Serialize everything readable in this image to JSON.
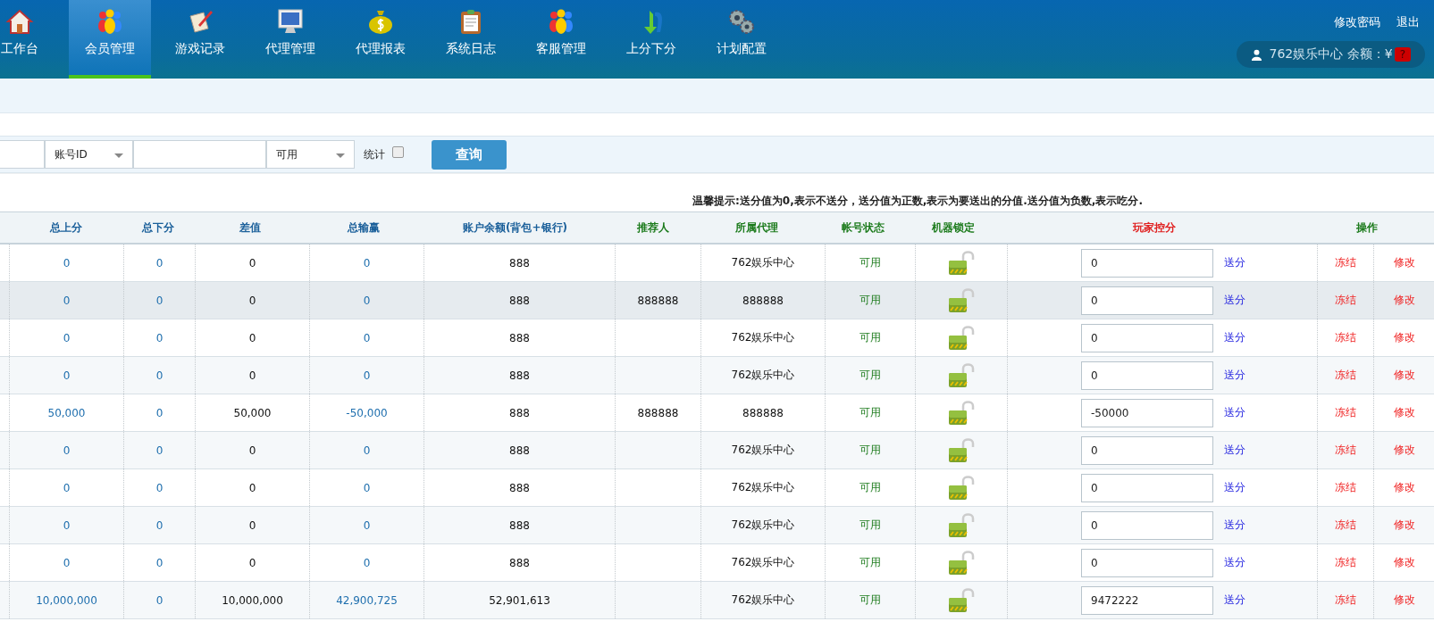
{
  "nav": [
    {
      "label": "工作台",
      "selected": false
    },
    {
      "label": "会员管理",
      "selected": true
    },
    {
      "label": "游戏记录",
      "selected": false
    },
    {
      "label": "代理管理",
      "selected": false
    },
    {
      "label": "代理报表",
      "selected": false
    },
    {
      "label": "系统日志",
      "selected": false
    },
    {
      "label": "客服管理",
      "selected": false
    },
    {
      "label": "上分下分",
      "selected": false
    },
    {
      "label": "计划配置",
      "selected": false
    }
  ],
  "top_links": [
    "修改密码",
    "退出"
  ],
  "account": {
    "text": "762娱乐中心 余额：¥",
    "badge": "?"
  },
  "filter": {
    "field_type": "账号ID",
    "status": "可用",
    "stat_label": "统计",
    "stat_checked": false,
    "query_button": "查询"
  },
  "notice": "温馨提示:送分值为0,表示不送分，送分值为正数,表示为要送出的分值.送分值为负数,表示吃分.",
  "table": {
    "columns": [
      "总上分",
      "总下分",
      "差值",
      "总输赢",
      "账户余额(背包+银行)",
      "推荐人",
      "所属代理",
      "帐号状态",
      "机器锁定",
      "玩家控分",
      "操作"
    ],
    "rows": [
      {
        "selected": false,
        "cells": [
          "0",
          "0",
          "0",
          "0",
          "888",
          "",
          "762娱乐中心",
          "可用"
        ],
        "score": "0",
        "actions": [
          "送分",
          "冻结",
          "修改"
        ]
      },
      {
        "selected": true,
        "cells": [
          "0",
          "0",
          "0",
          "0",
          "888",
          "888888",
          "888888",
          "可用"
        ],
        "score": "0",
        "actions": [
          "送分",
          "冻结",
          "修改"
        ]
      },
      {
        "selected": false,
        "cells": [
          "0",
          "0",
          "0",
          "0",
          "888",
          "",
          "762娱乐中心",
          "可用"
        ],
        "score": "0",
        "actions": [
          "送分",
          "冻结",
          "修改"
        ]
      },
      {
        "selected": false,
        "cells": [
          "0",
          "0",
          "0",
          "0",
          "888",
          "",
          "762娱乐中心",
          "可用"
        ],
        "score": "0",
        "actions": [
          "送分",
          "冻结",
          "修改"
        ]
      },
      {
        "selected": false,
        "cells": [
          "50,000",
          "0",
          "50,000",
          "-50,000",
          "888",
          "888888",
          "888888",
          "可用"
        ],
        "score": "-50000",
        "actions": [
          "送分",
          "冻结",
          "修改"
        ]
      },
      {
        "selected": false,
        "cells": [
          "0",
          "0",
          "0",
          "0",
          "888",
          "",
          "762娱乐中心",
          "可用"
        ],
        "score": "0",
        "actions": [
          "送分",
          "冻结",
          "修改"
        ]
      },
      {
        "selected": false,
        "cells": [
          "0",
          "0",
          "0",
          "0",
          "888",
          "",
          "762娱乐中心",
          "可用"
        ],
        "score": "0",
        "actions": [
          "送分",
          "冻结",
          "修改"
        ]
      },
      {
        "selected": false,
        "cells": [
          "0",
          "0",
          "0",
          "0",
          "888",
          "",
          "762娱乐中心",
          "可用"
        ],
        "score": "0",
        "actions": [
          "送分",
          "冻结",
          "修改"
        ]
      },
      {
        "selected": false,
        "cells": [
          "0",
          "0",
          "0",
          "0",
          "888",
          "",
          "762娱乐中心",
          "可用"
        ],
        "score": "0",
        "actions": [
          "送分",
          "冻结",
          "修改"
        ]
      },
      {
        "selected": false,
        "cells": [
          "10,000,000",
          "0",
          "10,000,000",
          "42,900,725",
          "52,901,613",
          "",
          "762娱乐中心",
          "可用"
        ],
        "score": "9472222",
        "actions": [
          "送分",
          "冻结",
          "修改"
        ]
      }
    ]
  }
}
